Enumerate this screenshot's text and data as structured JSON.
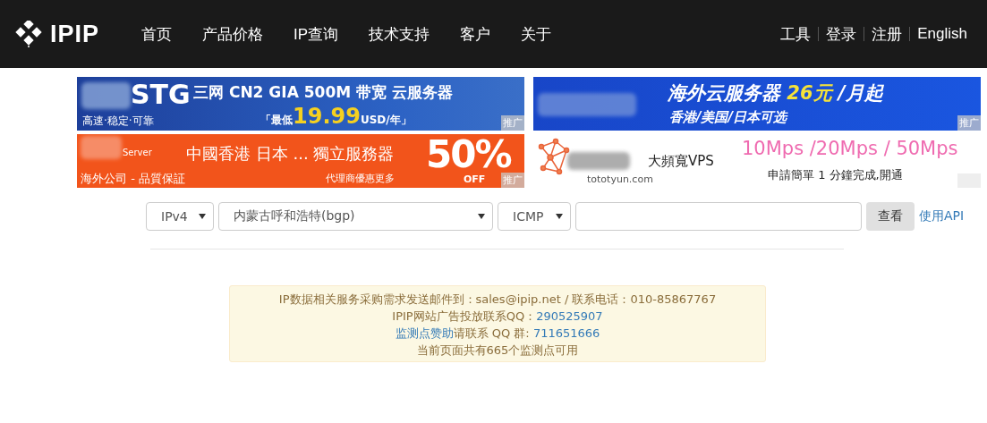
{
  "header": {
    "logo": "IPIP",
    "nav": [
      {
        "label": "首页"
      },
      {
        "label": "产品价格"
      },
      {
        "label": "IP查询"
      },
      {
        "label": "技术支持"
      },
      {
        "label": "客户"
      },
      {
        "label": "关于"
      }
    ],
    "right": [
      {
        "label": "工具"
      },
      {
        "label": "登录"
      },
      {
        "label": "注册"
      },
      {
        "label": "English"
      }
    ]
  },
  "banners": [
    {
      "kind": "stg",
      "brand": "STG",
      "slogan": "高速·稳定·可靠",
      "headline": "三网 CN2 GIA  500M 带宽 云服务器",
      "price_prefix": "「最低",
      "price": "19.99",
      "price_suffix": "USD/年」",
      "tag": "推广"
    },
    {
      "kind": "cloud",
      "headline": "海外云服务器",
      "price": "26元",
      "price_suffix": "/月起",
      "subline": "香港/美国/日本可选",
      "tag": "推广"
    },
    {
      "kind": "offer",
      "brand": "Server",
      "headline": "中國香港 日本 ... 獨立服務器",
      "slogan": "海外公司 - 品質保証",
      "subline": "代理商優惠更多",
      "price": "50%",
      "price_suffix": "OFF",
      "tag": "推广"
    },
    {
      "kind": "vps",
      "domain": "tototyun.com",
      "brand": "大頻寬VPS",
      "headline": "10Mps /20Mps / 50Mps",
      "subline": "申請簡單 1 分鐘完成,開通"
    }
  ],
  "query": {
    "protocol": "IPv4",
    "node": "内蒙古呼和浩特(bgp)",
    "method": "ICMP",
    "button": "查看",
    "api_link": "使用API"
  },
  "notice": [
    [
      {
        "text": "IP数据相关服务采购需求发送邮件到：sales@ipip.net / 联系电话：010-85867767",
        "link": false
      }
    ],
    [
      {
        "text": "IPIP网站广告投放联系QQ：",
        "link": false
      },
      {
        "text": "290525907",
        "link": true
      }
    ],
    [
      {
        "text": "监测点赞助",
        "link": true
      },
      {
        "text": "请联系 QQ 群: ",
        "link": false
      },
      {
        "text": "711651666",
        "link": true
      }
    ],
    [
      {
        "text": "当前页面共有665个监测点可用",
        "link": false
      }
    ]
  ]
}
